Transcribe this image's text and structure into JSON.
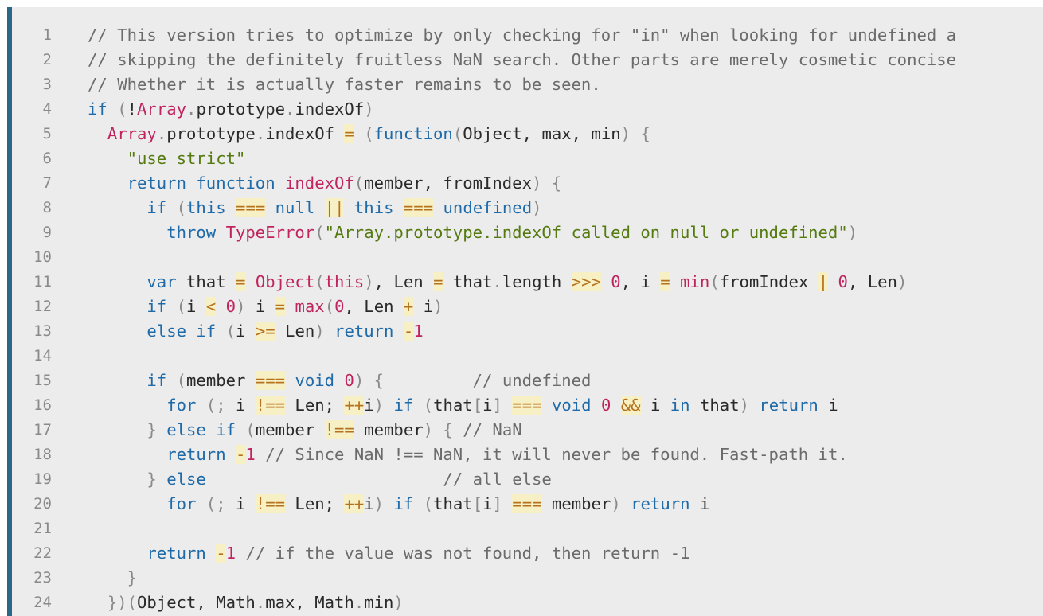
{
  "colors": {
    "background": "#ececec",
    "accent_bar": "#2b6787",
    "keyword": "#1f6aa8",
    "function": "#c0245e",
    "string": "#557a10",
    "comment": "#6b6b6b",
    "operator": "#b5721e",
    "line_number": "#8a8a8a"
  },
  "code": {
    "language": "javascript",
    "lines": [
      {
        "n": "1",
        "tokens": [
          {
            "t": "// This version tries to optimize by only checking for \"in\" when looking for undefined a",
            "c": "com"
          }
        ]
      },
      {
        "n": "2",
        "tokens": [
          {
            "t": "// skipping the definitely fruitless NaN search. Other parts are merely cosmetic concise",
            "c": "com"
          }
        ]
      },
      {
        "n": "3",
        "tokens": [
          {
            "t": "// Whether it is actually faster remains to be seen.",
            "c": "com"
          }
        ]
      },
      {
        "n": "4",
        "tokens": [
          {
            "t": "if",
            "c": "kw"
          },
          {
            "t": " (",
            "c": "punc"
          },
          {
            "t": "!",
            "c": "plain"
          },
          {
            "t": "Array",
            "c": "fn"
          },
          {
            "t": ".",
            "c": "punc"
          },
          {
            "t": "prototype",
            "c": "plain"
          },
          {
            "t": ".",
            "c": "punc"
          },
          {
            "t": "indexOf",
            "c": "plain"
          },
          {
            "t": ")",
            "c": "punc"
          }
        ]
      },
      {
        "n": "5",
        "tokens": [
          {
            "t": "  ",
            "c": "plain"
          },
          {
            "t": "Array",
            "c": "fn"
          },
          {
            "t": ".",
            "c": "punc"
          },
          {
            "t": "prototype",
            "c": "plain"
          },
          {
            "t": ".",
            "c": "punc"
          },
          {
            "t": "indexOf ",
            "c": "plain"
          },
          {
            "t": "=",
            "c": "op"
          },
          {
            "t": " (",
            "c": "punc"
          },
          {
            "t": "function",
            "c": "kw"
          },
          {
            "t": "(",
            "c": "punc"
          },
          {
            "t": "Object, max, min",
            "c": "plain"
          },
          {
            "t": ") {",
            "c": "punc"
          }
        ]
      },
      {
        "n": "6",
        "tokens": [
          {
            "t": "    ",
            "c": "plain"
          },
          {
            "t": "\"use strict\"",
            "c": "str"
          }
        ]
      },
      {
        "n": "7",
        "tokens": [
          {
            "t": "    ",
            "c": "plain"
          },
          {
            "t": "return function",
            "c": "kw"
          },
          {
            "t": " ",
            "c": "plain"
          },
          {
            "t": "indexOf",
            "c": "fn"
          },
          {
            "t": "(",
            "c": "punc"
          },
          {
            "t": "member, fromIndex",
            "c": "plain"
          },
          {
            "t": ") {",
            "c": "punc"
          }
        ]
      },
      {
        "n": "8",
        "tokens": [
          {
            "t": "      ",
            "c": "plain"
          },
          {
            "t": "if",
            "c": "kw"
          },
          {
            "t": " (",
            "c": "punc"
          },
          {
            "t": "this",
            "c": "kw"
          },
          {
            "t": " ",
            "c": "plain"
          },
          {
            "t": "===",
            "c": "op"
          },
          {
            "t": " ",
            "c": "plain"
          },
          {
            "t": "null",
            "c": "kw"
          },
          {
            "t": " ",
            "c": "plain"
          },
          {
            "t": "||",
            "c": "op"
          },
          {
            "t": " ",
            "c": "plain"
          },
          {
            "t": "this",
            "c": "kw"
          },
          {
            "t": " ",
            "c": "plain"
          },
          {
            "t": "===",
            "c": "op"
          },
          {
            "t": " ",
            "c": "plain"
          },
          {
            "t": "undefined",
            "c": "kw"
          },
          {
            "t": ")",
            "c": "punc"
          }
        ]
      },
      {
        "n": "9",
        "tokens": [
          {
            "t": "        ",
            "c": "plain"
          },
          {
            "t": "throw",
            "c": "kw"
          },
          {
            "t": " ",
            "c": "plain"
          },
          {
            "t": "TypeError",
            "c": "fn"
          },
          {
            "t": "(",
            "c": "punc"
          },
          {
            "t": "\"Array.prototype.indexOf called on null or undefined\"",
            "c": "str"
          },
          {
            "t": ")",
            "c": "punc"
          }
        ]
      },
      {
        "n": "10",
        "tokens": []
      },
      {
        "n": "11",
        "tokens": [
          {
            "t": "      ",
            "c": "plain"
          },
          {
            "t": "var",
            "c": "kw"
          },
          {
            "t": " that ",
            "c": "plain"
          },
          {
            "t": "=",
            "c": "op"
          },
          {
            "t": " ",
            "c": "plain"
          },
          {
            "t": "Object",
            "c": "fn"
          },
          {
            "t": "(",
            "c": "punc"
          },
          {
            "t": "this",
            "c": "fn"
          },
          {
            "t": ")",
            "c": "punc"
          },
          {
            "t": ", Len ",
            "c": "plain"
          },
          {
            "t": "=",
            "c": "op"
          },
          {
            "t": " that",
            "c": "plain"
          },
          {
            "t": ".",
            "c": "punc"
          },
          {
            "t": "length ",
            "c": "plain"
          },
          {
            "t": ">>>",
            "c": "op"
          },
          {
            "t": " ",
            "c": "plain"
          },
          {
            "t": "0",
            "c": "num"
          },
          {
            "t": ", i ",
            "c": "plain"
          },
          {
            "t": "=",
            "c": "op"
          },
          {
            "t": " ",
            "c": "plain"
          },
          {
            "t": "min",
            "c": "fn"
          },
          {
            "t": "(",
            "c": "punc"
          },
          {
            "t": "fromIndex ",
            "c": "plain"
          },
          {
            "t": "|",
            "c": "op"
          },
          {
            "t": " ",
            "c": "plain"
          },
          {
            "t": "0",
            "c": "num"
          },
          {
            "t": ", Len",
            "c": "plain"
          },
          {
            "t": ")",
            "c": "punc"
          }
        ]
      },
      {
        "n": "12",
        "tokens": [
          {
            "t": "      ",
            "c": "plain"
          },
          {
            "t": "if",
            "c": "kw"
          },
          {
            "t": " (",
            "c": "punc"
          },
          {
            "t": "i ",
            "c": "plain"
          },
          {
            "t": "<",
            "c": "op"
          },
          {
            "t": " ",
            "c": "plain"
          },
          {
            "t": "0",
            "c": "num"
          },
          {
            "t": ")",
            "c": "punc"
          },
          {
            "t": " i ",
            "c": "plain"
          },
          {
            "t": "=",
            "c": "op"
          },
          {
            "t": " ",
            "c": "plain"
          },
          {
            "t": "max",
            "c": "fn"
          },
          {
            "t": "(",
            "c": "punc"
          },
          {
            "t": "0",
            "c": "num"
          },
          {
            "t": ", Len ",
            "c": "plain"
          },
          {
            "t": "+",
            "c": "op"
          },
          {
            "t": " i",
            "c": "plain"
          },
          {
            "t": ")",
            "c": "punc"
          }
        ]
      },
      {
        "n": "13",
        "tokens": [
          {
            "t": "      ",
            "c": "plain"
          },
          {
            "t": "else if",
            "c": "kw"
          },
          {
            "t": " (",
            "c": "punc"
          },
          {
            "t": "i ",
            "c": "plain"
          },
          {
            "t": ">=",
            "c": "op"
          },
          {
            "t": " Len",
            "c": "plain"
          },
          {
            "t": ")",
            "c": "punc"
          },
          {
            "t": " ",
            "c": "plain"
          },
          {
            "t": "return",
            "c": "kw"
          },
          {
            "t": " ",
            "c": "plain"
          },
          {
            "t": "-",
            "c": "op"
          },
          {
            "t": "1",
            "c": "num"
          }
        ]
      },
      {
        "n": "14",
        "tokens": []
      },
      {
        "n": "15",
        "tokens": [
          {
            "t": "      ",
            "c": "plain"
          },
          {
            "t": "if",
            "c": "kw"
          },
          {
            "t": " (",
            "c": "punc"
          },
          {
            "t": "member ",
            "c": "plain"
          },
          {
            "t": "===",
            "c": "op"
          },
          {
            "t": " ",
            "c": "plain"
          },
          {
            "t": "void",
            "c": "kw"
          },
          {
            "t": " ",
            "c": "plain"
          },
          {
            "t": "0",
            "c": "num"
          },
          {
            "t": ") {",
            "c": "punc"
          },
          {
            "t": "         ",
            "c": "plain"
          },
          {
            "t": "// undefined",
            "c": "com"
          }
        ]
      },
      {
        "n": "16",
        "tokens": [
          {
            "t": "        ",
            "c": "plain"
          },
          {
            "t": "for",
            "c": "kw"
          },
          {
            "t": " (; ",
            "c": "punc"
          },
          {
            "t": "i ",
            "c": "plain"
          },
          {
            "t": "!==",
            "c": "op"
          },
          {
            "t": " Len; ",
            "c": "plain"
          },
          {
            "t": "++",
            "c": "op"
          },
          {
            "t": "i",
            "c": "plain"
          },
          {
            "t": ")",
            "c": "punc"
          },
          {
            "t": " ",
            "c": "plain"
          },
          {
            "t": "if",
            "c": "kw"
          },
          {
            "t": " (",
            "c": "punc"
          },
          {
            "t": "that",
            "c": "plain"
          },
          {
            "t": "[",
            "c": "punc"
          },
          {
            "t": "i",
            "c": "plain"
          },
          {
            "t": "]",
            "c": "punc"
          },
          {
            "t": " ",
            "c": "plain"
          },
          {
            "t": "===",
            "c": "op"
          },
          {
            "t": " ",
            "c": "plain"
          },
          {
            "t": "void",
            "c": "kw"
          },
          {
            "t": " ",
            "c": "plain"
          },
          {
            "t": "0",
            "c": "num"
          },
          {
            "t": " ",
            "c": "plain"
          },
          {
            "t": "&&",
            "c": "op"
          },
          {
            "t": " i ",
            "c": "plain"
          },
          {
            "t": "in",
            "c": "kw"
          },
          {
            "t": " that",
            "c": "plain"
          },
          {
            "t": ")",
            "c": "punc"
          },
          {
            "t": " ",
            "c": "plain"
          },
          {
            "t": "return",
            "c": "kw"
          },
          {
            "t": " i",
            "c": "plain"
          }
        ]
      },
      {
        "n": "17",
        "tokens": [
          {
            "t": "      ",
            "c": "plain"
          },
          {
            "t": "}",
            "c": "punc"
          },
          {
            "t": " ",
            "c": "plain"
          },
          {
            "t": "else if",
            "c": "kw"
          },
          {
            "t": " (",
            "c": "punc"
          },
          {
            "t": "member ",
            "c": "plain"
          },
          {
            "t": "!==",
            "c": "op"
          },
          {
            "t": " member",
            "c": "plain"
          },
          {
            "t": ") {",
            "c": "punc"
          },
          {
            "t": " ",
            "c": "plain"
          },
          {
            "t": "// NaN",
            "c": "com"
          }
        ]
      },
      {
        "n": "18",
        "tokens": [
          {
            "t": "        ",
            "c": "plain"
          },
          {
            "t": "return",
            "c": "kw"
          },
          {
            "t": " ",
            "c": "plain"
          },
          {
            "t": "-",
            "c": "op"
          },
          {
            "t": "1",
            "c": "num"
          },
          {
            "t": " ",
            "c": "plain"
          },
          {
            "t": "// Since NaN !== NaN, it will never be found. Fast-path it.",
            "c": "com"
          }
        ]
      },
      {
        "n": "19",
        "tokens": [
          {
            "t": "      ",
            "c": "plain"
          },
          {
            "t": "}",
            "c": "punc"
          },
          {
            "t": " ",
            "c": "plain"
          },
          {
            "t": "else",
            "c": "kw"
          },
          {
            "t": "                        ",
            "c": "plain"
          },
          {
            "t": "// all else",
            "c": "com"
          }
        ]
      },
      {
        "n": "20",
        "tokens": [
          {
            "t": "        ",
            "c": "plain"
          },
          {
            "t": "for",
            "c": "kw"
          },
          {
            "t": " (; ",
            "c": "punc"
          },
          {
            "t": "i ",
            "c": "plain"
          },
          {
            "t": "!==",
            "c": "op"
          },
          {
            "t": " Len; ",
            "c": "plain"
          },
          {
            "t": "++",
            "c": "op"
          },
          {
            "t": "i",
            "c": "plain"
          },
          {
            "t": ")",
            "c": "punc"
          },
          {
            "t": " ",
            "c": "plain"
          },
          {
            "t": "if",
            "c": "kw"
          },
          {
            "t": " (",
            "c": "punc"
          },
          {
            "t": "that",
            "c": "plain"
          },
          {
            "t": "[",
            "c": "punc"
          },
          {
            "t": "i",
            "c": "plain"
          },
          {
            "t": "]",
            "c": "punc"
          },
          {
            "t": " ",
            "c": "plain"
          },
          {
            "t": "===",
            "c": "op"
          },
          {
            "t": " member",
            "c": "plain"
          },
          {
            "t": ")",
            "c": "punc"
          },
          {
            "t": " ",
            "c": "plain"
          },
          {
            "t": "return",
            "c": "kw"
          },
          {
            "t": " i",
            "c": "plain"
          }
        ]
      },
      {
        "n": "21",
        "tokens": []
      },
      {
        "n": "22",
        "tokens": [
          {
            "t": "      ",
            "c": "plain"
          },
          {
            "t": "return",
            "c": "kw"
          },
          {
            "t": " ",
            "c": "plain"
          },
          {
            "t": "-",
            "c": "op"
          },
          {
            "t": "1",
            "c": "num"
          },
          {
            "t": " ",
            "c": "plain"
          },
          {
            "t": "// if the value was not found, then return -1",
            "c": "com"
          }
        ]
      },
      {
        "n": "23",
        "tokens": [
          {
            "t": "    ",
            "c": "plain"
          },
          {
            "t": "}",
            "c": "punc"
          }
        ]
      },
      {
        "n": "24",
        "tokens": [
          {
            "t": "  ",
            "c": "plain"
          },
          {
            "t": "})(",
            "c": "punc"
          },
          {
            "t": "Object, Math",
            "c": "plain"
          },
          {
            "t": ".",
            "c": "punc"
          },
          {
            "t": "max, Math",
            "c": "plain"
          },
          {
            "t": ".",
            "c": "punc"
          },
          {
            "t": "min",
            "c": "plain"
          },
          {
            "t": ")",
            "c": "punc"
          }
        ]
      }
    ]
  }
}
